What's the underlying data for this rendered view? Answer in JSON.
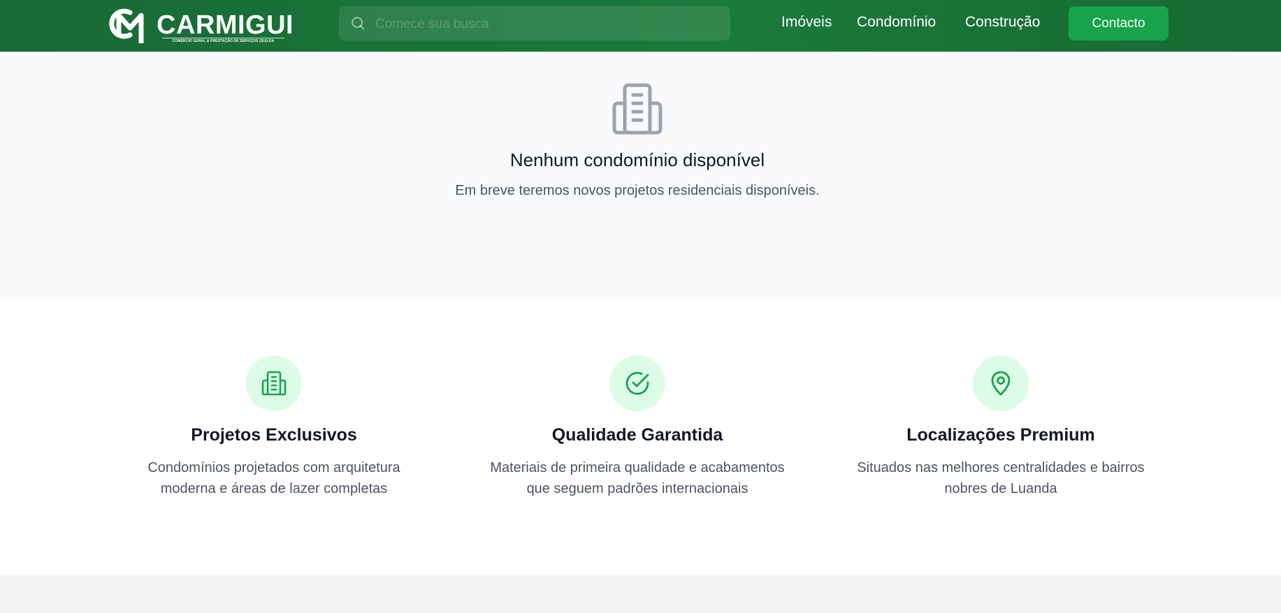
{
  "header": {
    "logo_text": "CARMIGUI",
    "logo_subtitle": "COMÉRCIO GERAL & PRESTAÇÃO DE SERVIÇOS (SU)LDA",
    "search_placeholder": "Comece sua busca",
    "nav": [
      "Imóveis",
      "Condomínio",
      "Construção"
    ],
    "contact_label": "Contacto"
  },
  "empty_state": {
    "icon": "building-icon",
    "title": "Nenhum condomínio disponível",
    "description": "Em breve teremos novos projetos residenciais disponíveis."
  },
  "features": [
    {
      "icon": "building-icon",
      "title": "Projetos Exclusivos",
      "description": "Condomínios projetados com arquitetura moderna e áreas de lazer completas"
    },
    {
      "icon": "check-circle-icon",
      "title": "Qualidade Garantida",
      "description": "Materiais de primeira qualidade e acabamentos que seguem padrões internacionais"
    },
    {
      "icon": "map-pin-icon",
      "title": "Localizações Premium",
      "description": "Situados nas melhores centralidades e bairros nobres de Luanda"
    }
  ],
  "colors": {
    "header_green": "#1b7a3b",
    "accent_green": "#16a34a",
    "feature_circle": "#dcfce7",
    "gray_icon": "#9ca3af"
  }
}
